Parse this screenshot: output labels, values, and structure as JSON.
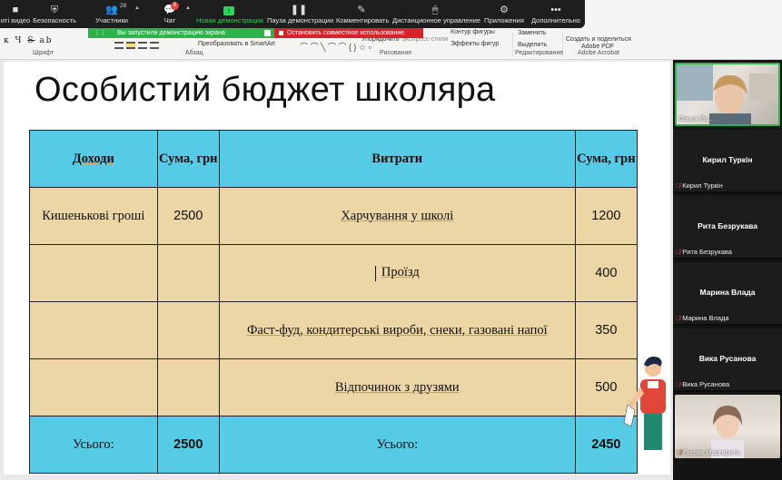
{
  "zoom_toolbar": {
    "buttons": [
      {
        "label": "иті видео",
        "icon": "video-off-icon"
      },
      {
        "label": "Безопасность",
        "icon": "shield-icon"
      },
      {
        "label": "Участники",
        "icon": "participants-icon",
        "count": "28"
      },
      {
        "label": "Чат",
        "icon": "chat-icon",
        "badge": "6"
      },
      {
        "label": "Новая демонстрация",
        "icon": "share-screen-icon"
      },
      {
        "label": "Пауза демонстрации",
        "icon": "pause-icon"
      },
      {
        "label": "Комментировать",
        "icon": "pencil-icon"
      },
      {
        "label": "Дистанционное управление",
        "icon": "mouse-icon"
      },
      {
        "label": "Приложения",
        "icon": "apps-icon"
      },
      {
        "label": "Дополнительно",
        "icon": "more-icon"
      }
    ],
    "share_banner": "Вы запустили демонстрацию экрана",
    "stop_banner": "Остановить совместное использование"
  },
  "ribbon": {
    "convert_smartart": "Преобразовать в SmartArt",
    "arrange": "Упорядочить",
    "quick_styles": "Экспресс-стили",
    "shape_outline": "Контур фигуры",
    "shape_effects": "Эффекты фигур",
    "replace": "Заменить",
    "select": "Выделить",
    "adobe_create": "Создать и поделиться",
    "adobe_pdf": "Adobe PDF",
    "groups": [
      "Шрифт",
      "Абзац",
      "Рисование",
      "Редактирование",
      "Adobe Acrobat"
    ]
  },
  "slide": {
    "title": "Особистий бюджет школяра",
    "table": {
      "headers": [
        "Доходи",
        "Сума, грн",
        "Витрати",
        "Сума, грн"
      ],
      "rows": [
        {
          "income": "Кишенькові гроші",
          "income_sum": "2500",
          "expense": "Харчування у школі",
          "expense_sum": "1200"
        },
        {
          "income": "",
          "income_sum": "",
          "expense": "Проїзд",
          "expense_sum": "400"
        },
        {
          "income": "",
          "income_sum": "",
          "expense": "Фаст-фуд, кондитерські вироби, снеки, газовані напої",
          "expense_sum": "350"
        },
        {
          "income": "",
          "income_sum": "",
          "expense": "Відпочинок з друзями",
          "expense_sum": "500"
        }
      ],
      "total": {
        "income_label": "Усього:",
        "income_sum": "2500",
        "expense_label": "Усього:",
        "expense_sum": "2450"
      }
    }
  },
  "participants": [
    {
      "name": "Ольга Ра...",
      "video": true
    },
    {
      "name": "Кирил Туркін",
      "label": "Кирил Туркін",
      "video": false,
      "muted": true
    },
    {
      "name": "Рита Безрукава",
      "label": "Рита Безрукава",
      "video": false,
      "muted": true
    },
    {
      "name": "Марина Влада",
      "label": "Марина Влада",
      "video": false,
      "muted": true
    },
    {
      "name": "Вика Русанова",
      "label": "Вика Русанова",
      "video": false,
      "muted": true
    },
    {
      "name": "Гусєва Маргарита",
      "video": true,
      "muted": true
    }
  ],
  "colors": {
    "zoom_green": "#2bd25b",
    "stop_red": "#d8232a",
    "table_header_blue": "#55cbe6",
    "table_row_tan": "#ecd6a6"
  }
}
